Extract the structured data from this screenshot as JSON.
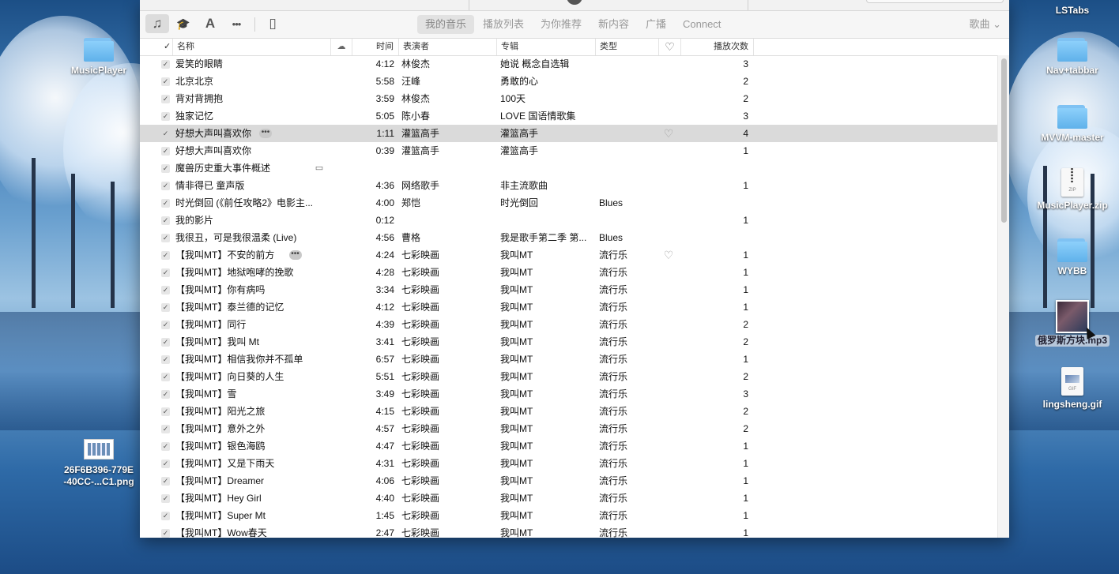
{
  "desktop": {
    "icons": [
      {
        "label": "MusicPlayer",
        "kind": "folder"
      },
      {
        "label": "26F6B396-779E\n-40CC-...C1.png",
        "kind": "image"
      },
      {
        "label": "LSTabs",
        "kind": "folder"
      },
      {
        "label": "Nav+tabbar",
        "kind": "folder"
      },
      {
        "label": "MVVM-master",
        "kind": "folder"
      },
      {
        "label": "MusicPlayer.zip",
        "kind": "zip"
      },
      {
        "label": "WYBB",
        "kind": "folder"
      },
      {
        "label": "俄罗斯方块.mp3",
        "kind": "mp3"
      },
      {
        "label": "lingsheng.gif",
        "kind": "gif"
      }
    ]
  },
  "toolbar": {
    "icons": [
      "music-note-icon",
      "graduation-cap-icon",
      "app-store-icon",
      "more-icon",
      "device-icon"
    ],
    "icon_glyphs": [
      "♫",
      "🎓",
      "A",
      "•••",
      "▯"
    ],
    "tabs": [
      "我的音乐",
      "播放列表",
      "为你推荐",
      "新内容",
      "广播",
      "Connect"
    ],
    "active_tab": "我的音乐",
    "sort_label": "歌曲 ⌄"
  },
  "columns": {
    "check": "✓",
    "name": "名称",
    "cloud": "☁",
    "time": "时间",
    "artist": "表演者",
    "album": "专辑",
    "genre": "类型",
    "love": "♡",
    "plays": "播放次数"
  },
  "tracks": [
    {
      "name": "爱笑的眼睛",
      "time": "4:12",
      "artist": "林俊杰",
      "album": "她说 概念自选辑",
      "genre": "",
      "plays": "3"
    },
    {
      "name": "北京北京",
      "time": "5:58",
      "artist": "汪峰",
      "album": "勇敢的心",
      "genre": "",
      "plays": "2"
    },
    {
      "name": "背对背拥抱",
      "time": "3:59",
      "artist": "林俊杰",
      "album": "100天",
      "genre": "",
      "plays": "2"
    },
    {
      "name": "独家记忆",
      "time": "5:05",
      "artist": "陈小春",
      "album": "LOVE 国语情歌集",
      "genre": "",
      "plays": "3"
    },
    {
      "name": "好想大声叫喜欢你",
      "time": "1:11",
      "artist": "灌篮高手",
      "album": "灌篮高手",
      "genre": "",
      "plays": "4",
      "selected": true,
      "more": true,
      "heart": true
    },
    {
      "name": "好想大声叫喜欢你",
      "time": "0:39",
      "artist": "灌篮高手",
      "album": "灌篮高手",
      "genre": "",
      "plays": "1"
    },
    {
      "name": "魔兽历史重大事件概述",
      "time": "",
      "artist": "",
      "album": "",
      "genre": "",
      "plays": "",
      "cloud": true
    },
    {
      "name": "情非得已 童声版",
      "time": "4:36",
      "artist": "网络歌手",
      "album": "非主流歌曲",
      "genre": "",
      "plays": "1"
    },
    {
      "name": "时光倒回 (《前任攻略2》电影主...",
      "time": "4:00",
      "artist": "郑恺",
      "album": "时光倒回",
      "genre": "Blues",
      "plays": ""
    },
    {
      "name": "我的影片",
      "time": "0:12",
      "artist": "",
      "album": "",
      "genre": "",
      "plays": "1"
    },
    {
      "name": "我很丑，可是我很温柔 (Live)",
      "time": "4:56",
      "artist": "曹格",
      "album": "我是歌手第二季 第...",
      "genre": "Blues",
      "plays": ""
    },
    {
      "name": "【我叫MT】不安的前方",
      "time": "4:24",
      "artist": "七彩映画",
      "album": "我叫MT",
      "genre": "流行乐",
      "plays": "1",
      "more": true,
      "heart": true
    },
    {
      "name": "【我叫MT】地狱咆哮的挽歌",
      "time": "4:28",
      "artist": "七彩映画",
      "album": "我叫MT",
      "genre": "流行乐",
      "plays": "1"
    },
    {
      "name": "【我叫MT】你有病吗",
      "time": "3:34",
      "artist": "七彩映画",
      "album": "我叫MT",
      "genre": "流行乐",
      "plays": "1"
    },
    {
      "name": "【我叫MT】泰兰德的记忆",
      "time": "4:12",
      "artist": "七彩映画",
      "album": "我叫MT",
      "genre": "流行乐",
      "plays": "1"
    },
    {
      "name": "【我叫MT】同行",
      "time": "4:39",
      "artist": "七彩映画",
      "album": "我叫MT",
      "genre": "流行乐",
      "plays": "2"
    },
    {
      "name": "【我叫MT】我叫 Mt",
      "time": "3:41",
      "artist": "七彩映画",
      "album": "我叫MT",
      "genre": "流行乐",
      "plays": "2"
    },
    {
      "name": "【我叫MT】相信我你并不孤单",
      "time": "6:57",
      "artist": "七彩映画",
      "album": "我叫MT",
      "genre": "流行乐",
      "plays": "1"
    },
    {
      "name": "【我叫MT】向日葵的人生",
      "time": "5:51",
      "artist": "七彩映画",
      "album": "我叫MT",
      "genre": "流行乐",
      "plays": "2"
    },
    {
      "name": "【我叫MT】雪",
      "time": "3:49",
      "artist": "七彩映画",
      "album": "我叫MT",
      "genre": "流行乐",
      "plays": "3"
    },
    {
      "name": "【我叫MT】阳光之旅",
      "time": "4:15",
      "artist": "七彩映画",
      "album": "我叫MT",
      "genre": "流行乐",
      "plays": "2"
    },
    {
      "name": "【我叫MT】意外之外",
      "time": "4:57",
      "artist": "七彩映画",
      "album": "我叫MT",
      "genre": "流行乐",
      "plays": "2"
    },
    {
      "name": "【我叫MT】银色海鸥",
      "time": "4:47",
      "artist": "七彩映画",
      "album": "我叫MT",
      "genre": "流行乐",
      "plays": "1"
    },
    {
      "name": "【我叫MT】又是下雨天",
      "time": "4:31",
      "artist": "七彩映画",
      "album": "我叫MT",
      "genre": "流行乐",
      "plays": "1"
    },
    {
      "name": "【我叫MT】Dreamer",
      "time": "4:06",
      "artist": "七彩映画",
      "album": "我叫MT",
      "genre": "流行乐",
      "plays": "1"
    },
    {
      "name": "【我叫MT】Hey Girl",
      "time": "4:40",
      "artist": "七彩映画",
      "album": "我叫MT",
      "genre": "流行乐",
      "plays": "1"
    },
    {
      "name": "【我叫MT】Super Mt",
      "time": "1:45",
      "artist": "七彩映画",
      "album": "我叫MT",
      "genre": "流行乐",
      "plays": "1"
    },
    {
      "name": "【我叫MT】Wow春天",
      "time": "2:47",
      "artist": "七彩映画",
      "album": "我叫MT",
      "genre": "流行乐",
      "plays": "1"
    }
  ],
  "glyphs": {
    "check": "✓",
    "more": "•••",
    "heart": "♡",
    "cloud_item": "▭"
  }
}
